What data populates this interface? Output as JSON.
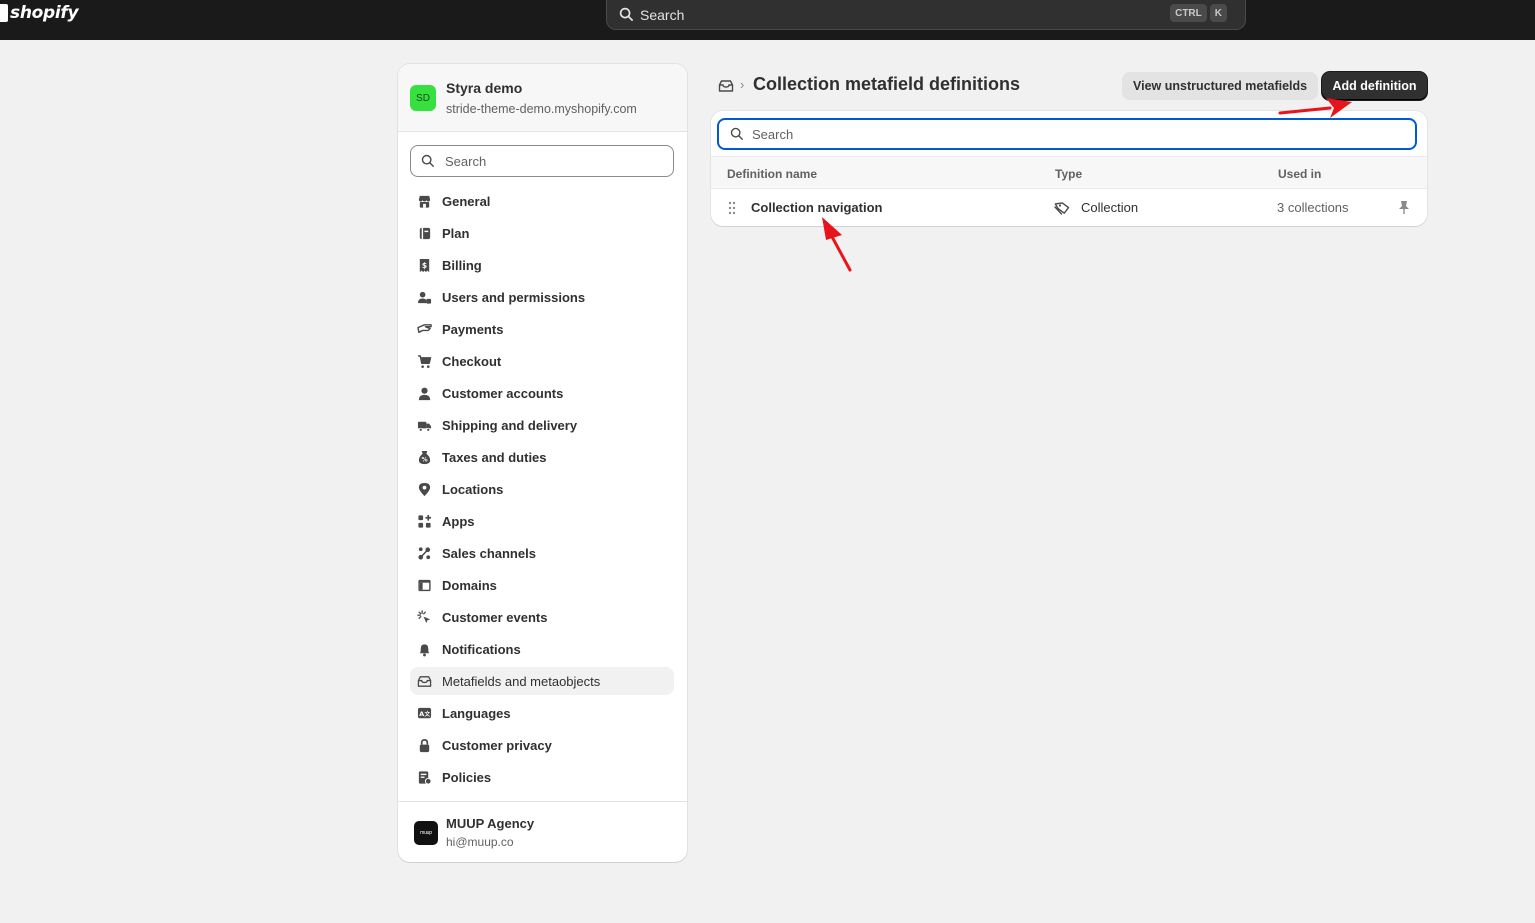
{
  "topbar": {
    "logo_text": "shopify",
    "search_placeholder": "Search",
    "shortcut_keys": [
      "CTRL",
      "K"
    ]
  },
  "sidebar": {
    "store": {
      "initials": "SD",
      "name": "Styra demo",
      "domain": "stride-theme-demo.myshopify.com",
      "avatar_color": "#36e03f"
    },
    "search_placeholder": "Search",
    "items": [
      {
        "label": "General",
        "icon": "store-icon"
      },
      {
        "label": "Plan",
        "icon": "plan-icon"
      },
      {
        "label": "Billing",
        "icon": "billing-icon"
      },
      {
        "label": "Users and permissions",
        "icon": "users-icon"
      },
      {
        "label": "Payments",
        "icon": "payments-icon"
      },
      {
        "label": "Checkout",
        "icon": "cart-icon"
      },
      {
        "label": "Customer accounts",
        "icon": "person-icon"
      },
      {
        "label": "Shipping and delivery",
        "icon": "truck-icon"
      },
      {
        "label": "Taxes and duties",
        "icon": "taxes-icon"
      },
      {
        "label": "Locations",
        "icon": "location-pin-icon"
      },
      {
        "label": "Apps",
        "icon": "apps-icon"
      },
      {
        "label": "Sales channels",
        "icon": "sales-channels-icon"
      },
      {
        "label": "Domains",
        "icon": "globe-icon"
      },
      {
        "label": "Customer events",
        "icon": "cursor-click-icon"
      },
      {
        "label": "Notifications",
        "icon": "bell-icon"
      },
      {
        "label": "Metafields and metaobjects",
        "icon": "metafields-icon",
        "active": true
      },
      {
        "label": "Languages",
        "icon": "language-icon"
      },
      {
        "label": "Customer privacy",
        "icon": "lock-icon"
      },
      {
        "label": "Policies",
        "icon": "policies-icon"
      }
    ],
    "account": {
      "logo_text": "muup",
      "name": "MUUP Agency",
      "email": "hi@muup.co"
    }
  },
  "main": {
    "title": "Collection metafield definitions",
    "view_unstructured_label": "View unstructured metafields",
    "add_definition_label": "Add definition",
    "search_placeholder": "Search",
    "columns": [
      "Definition name",
      "Type",
      "Used in"
    ],
    "rows": [
      {
        "name": "Collection navigation",
        "type": "Collection",
        "used_in": "3 collections"
      }
    ]
  },
  "colors": {
    "topbar": "#1a1a1a",
    "primary_button": "#303030",
    "focus_ring": "#005bd3",
    "annotation_arrow": "#e8141c"
  }
}
